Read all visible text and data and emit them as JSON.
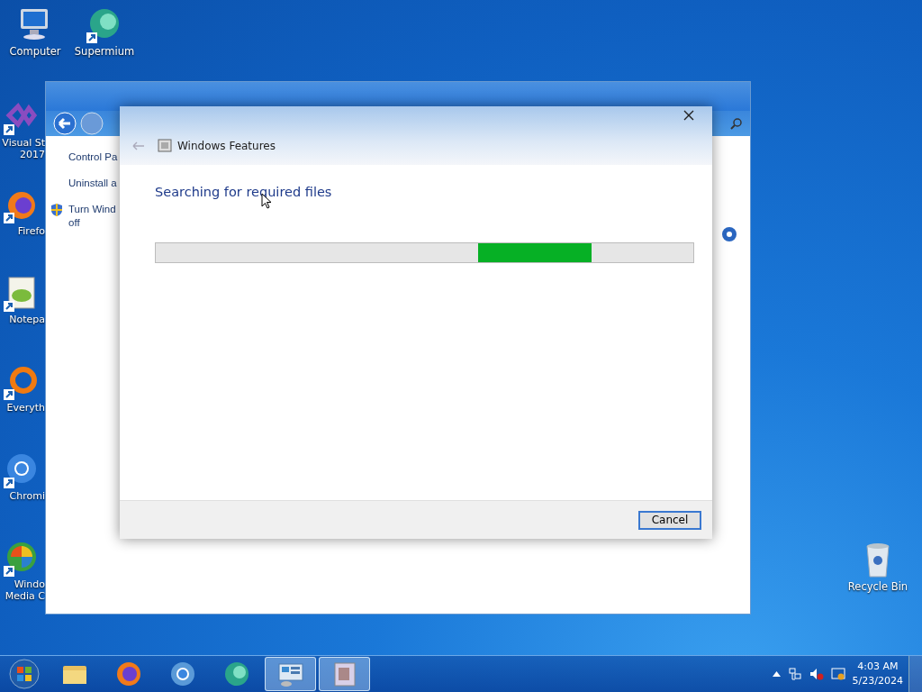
{
  "desktop_icons": [
    {
      "lines": [
        "Computer"
      ]
    },
    {
      "lines": [
        "Supermium"
      ]
    }
  ],
  "covered_desktop_icons": [
    {
      "lines": [
        "Visual St",
        "2017"
      ]
    },
    {
      "lines": [
        "Firefo"
      ]
    },
    {
      "lines": [
        "Notepa"
      ]
    },
    {
      "lines": [
        "Everyth"
      ]
    },
    {
      "lines": [
        "Chromi"
      ]
    },
    {
      "lines": [
        "Windo",
        "Media C"
      ]
    }
  ],
  "recycle_bin": {
    "label": "Recycle Bin"
  },
  "control_panel": {
    "sidebar": [
      {
        "lines": [
          "Control Pa"
        ],
        "shield": false
      },
      {
        "lines": [
          "Uninstall a"
        ],
        "shield": false
      },
      {
        "lines": [
          "Turn Wind",
          "off"
        ],
        "shield": true
      }
    ]
  },
  "dialog": {
    "title": "Windows Features",
    "heading": "Searching for required files",
    "progress": {
      "kind": "marquee"
    },
    "buttons": [
      "Cancel"
    ]
  },
  "taskbar": {
    "pinned": [
      {
        "active": false
      },
      {
        "active": false
      },
      {
        "active": false
      },
      {
        "active": false
      },
      {
        "active": true
      },
      {
        "active": true
      }
    ],
    "clock": {
      "time": "4:03 AM",
      "date": "5/23/2024"
    }
  }
}
